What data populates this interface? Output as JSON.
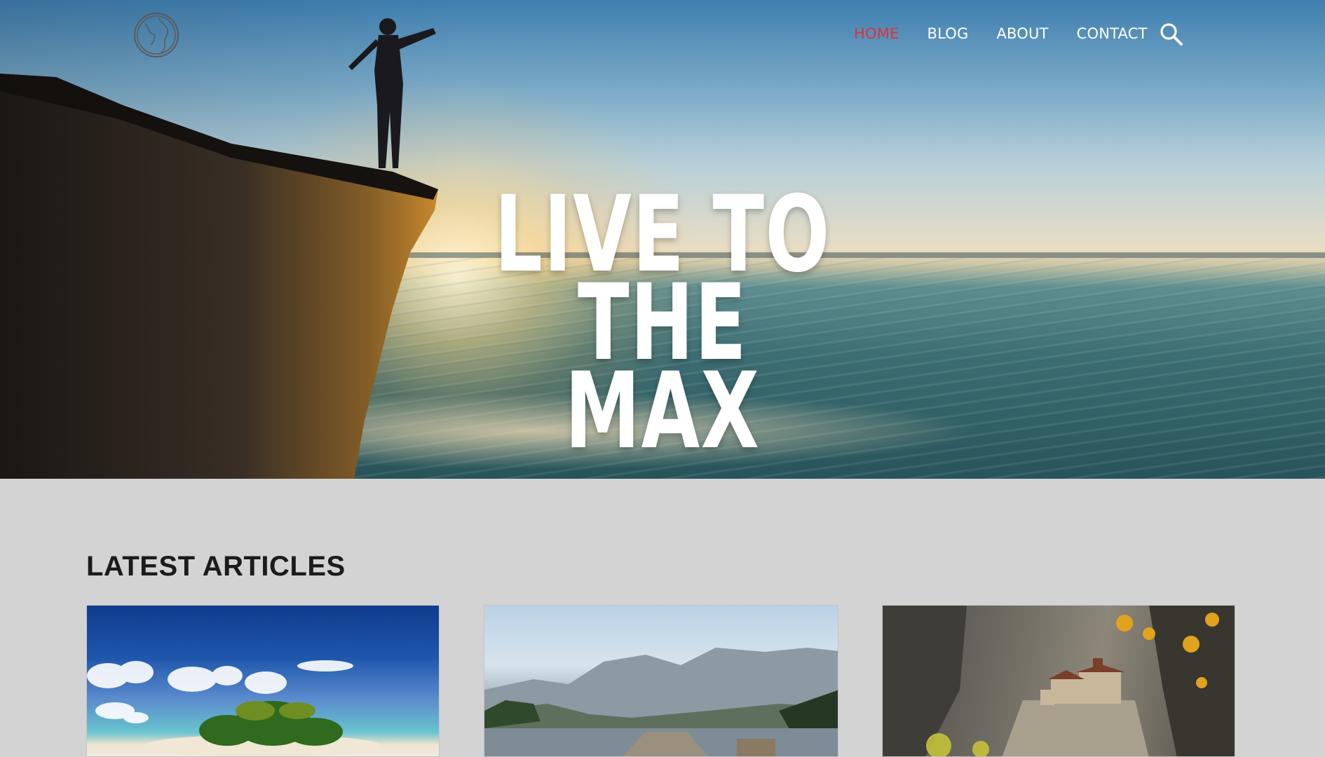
{
  "nav": {
    "items": [
      {
        "label": "HOME",
        "active": true
      },
      {
        "label": "BLOG",
        "active": false
      },
      {
        "label": "ABOUT",
        "active": false
      },
      {
        "label": "CONTACT",
        "active": false
      }
    ],
    "search_icon": "search-icon",
    "logo_icon": "globe-icon",
    "active_color": "#e0303e"
  },
  "hero": {
    "title_line1": "LIVE TO THE",
    "title_line2": "MAX"
  },
  "articles": {
    "heading": "LATEST ARTICLES",
    "cards": [
      {
        "image": "tropical-island-photo"
      },
      {
        "image": "mountain-lake-photo"
      },
      {
        "image": "cliff-monastery-photo"
      }
    ]
  }
}
